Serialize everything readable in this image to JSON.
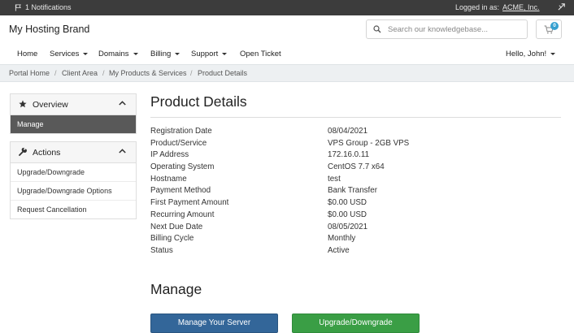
{
  "topbar": {
    "notifications_label": "1 Notifications",
    "logged_in_label": "Logged in as:",
    "account_name": "ACME, Inc."
  },
  "header": {
    "brand": "My Hosting Brand",
    "search_placeholder": "Search our knowledgebase...",
    "cart_count": "0"
  },
  "nav": {
    "home": "Home",
    "services": "Services",
    "domains": "Domains",
    "billing": "Billing",
    "support": "Support",
    "open_ticket": "Open Ticket",
    "user_greeting": "Hello, John!"
  },
  "breadcrumb": {
    "items": [
      "Portal Home",
      "Client Area",
      "My Products & Services",
      "Product Details"
    ],
    "separator": "/"
  },
  "sidebar": {
    "overview": {
      "title": "Overview",
      "items": [
        "Manage"
      ]
    },
    "actions": {
      "title": "Actions",
      "items": [
        "Upgrade/Downgrade",
        "Upgrade/Downgrade Options",
        "Request Cancellation"
      ]
    }
  },
  "main": {
    "title": "Product Details",
    "details": [
      {
        "label": "Registration Date",
        "value": "08/04/2021"
      },
      {
        "label": "Product/Service",
        "value": "VPS Group - 2GB VPS"
      },
      {
        "label": "IP Address",
        "value": "172.16.0.11"
      },
      {
        "label": "Operating System",
        "value": "CentOS 7.7 x64"
      },
      {
        "label": "Hostname",
        "value": "test"
      },
      {
        "label": "Payment Method",
        "value": "Bank Transfer"
      },
      {
        "label": "First Payment Amount",
        "value": "$0.00 USD"
      },
      {
        "label": "Recurring Amount",
        "value": "$0.00 USD"
      },
      {
        "label": "Next Due Date",
        "value": "08/05/2021"
      },
      {
        "label": "Billing Cycle",
        "value": "Monthly"
      },
      {
        "label": "Status",
        "value": "Active"
      }
    ],
    "manage_title": "Manage",
    "manage_server_button": "Manage Your Server",
    "upgrade_button": "Upgrade/Downgrade"
  },
  "colors": {
    "topbar": "#3c3c3c",
    "active_item": "#595959",
    "primary_button": "#336699",
    "success_button": "#3a9e45",
    "cart_badge": "#35a0d0"
  },
  "icons": {
    "notifications": "flag-icon",
    "account": "share-icon",
    "search": "search-icon",
    "cart": "cart-icon",
    "overview": "star-icon",
    "actions": "wrench-icon",
    "collapse": "chevron-up-icon"
  }
}
